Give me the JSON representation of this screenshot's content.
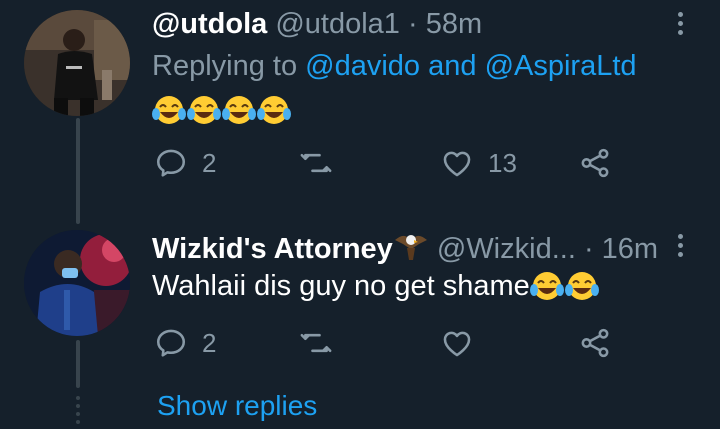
{
  "tweets": [
    {
      "display_name": "@utdola",
      "handle": "@utdola1",
      "time": "· 58m",
      "replying_prefix": "Replying to",
      "replying_to_1": "@davido",
      "replying_and": "and",
      "replying_to_2": "@AspiraLtd",
      "emoji": [
        "face-with-tears-of-joy",
        "face-with-tears-of-joy",
        "face-with-tears-of-joy",
        "face-with-tears-of-joy"
      ],
      "reply_count": "2",
      "retweet_count": "",
      "like_count": "13"
    },
    {
      "display_name": "Wizkid's Attorney",
      "name_emoji": "eagle",
      "handle": "@Wizkid...",
      "time": "· 16m",
      "text": "Wahlaii dis guy no get shame",
      "emoji": [
        "face-with-tears-of-joy",
        "face-with-tears-of-joy"
      ],
      "reply_count": "2",
      "retweet_count": "",
      "like_count": ""
    }
  ],
  "show_replies_label": "Show replies",
  "colors": {
    "background": "#15202b",
    "secondary_text": "#8899a6",
    "accent": "#1da1f2",
    "thread_line": "#38444d"
  }
}
